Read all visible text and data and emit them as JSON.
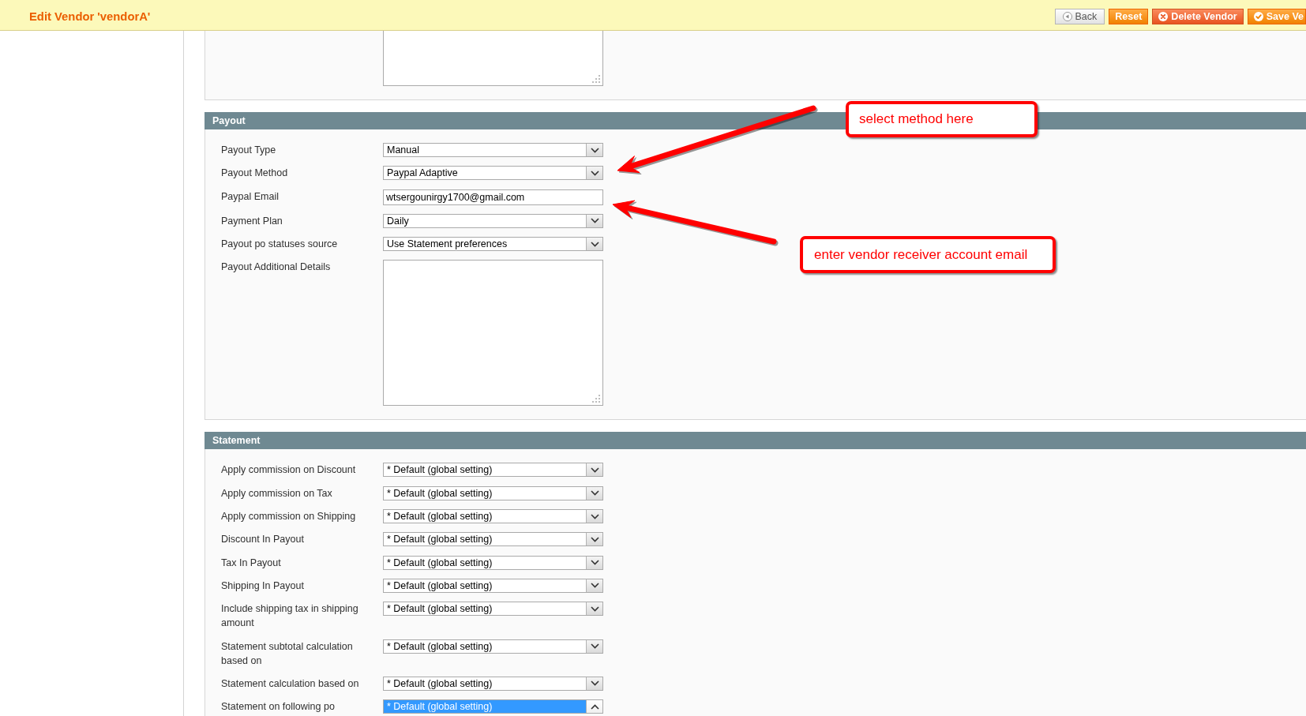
{
  "header": {
    "title": "Edit Vendor 'vendorA'",
    "buttons": [
      {
        "label": "Back",
        "kind": "back"
      },
      {
        "label": "Reset",
        "kind": "reset"
      },
      {
        "label": "Delete Vendor",
        "kind": "delete"
      },
      {
        "label": "Save Ve",
        "kind": "save"
      }
    ]
  },
  "sections": [
    {
      "fields": [
        {
          "kind": "textarea"
        }
      ]
    },
    {
      "title": "Payout",
      "fields": [
        {
          "label": "Payout Type",
          "kind": "select",
          "value": "Manual",
          "expanded": false
        },
        {
          "label": "Payout Method",
          "kind": "select",
          "value": "Paypal Adaptive",
          "expanded": false
        },
        {
          "label": "Paypal Email",
          "kind": "text",
          "value": "wtsergounirgy1700@gmail.com"
        },
        {
          "label": "Payment Plan",
          "kind": "select",
          "value": "Daily",
          "expanded": false
        },
        {
          "label": "Payout po statuses source",
          "kind": "select",
          "value": "Use Statement preferences",
          "expanded": false
        },
        {
          "label": "Payout Additional Details",
          "kind": "textarea"
        }
      ]
    },
    {
      "title": "Statement",
      "fields": [
        {
          "label": "Apply commission on Discount",
          "kind": "select",
          "value": "* Default (global setting)",
          "expanded": false
        },
        {
          "label": "Apply commission on Tax",
          "kind": "select",
          "value": "* Default (global setting)",
          "expanded": false
        },
        {
          "label": "Apply commission on Shipping",
          "kind": "select",
          "value": "* Default (global setting)",
          "expanded": false
        },
        {
          "label": "Discount In Payout",
          "kind": "select",
          "value": "* Default (global setting)",
          "expanded": false
        },
        {
          "label": "Tax In Payout",
          "kind": "select",
          "value": "* Default (global setting)",
          "expanded": false
        },
        {
          "label": "Shipping In Payout",
          "kind": "select",
          "value": "* Default (global setting)",
          "expanded": false
        },
        {
          "label": "Include shipping tax in shipping amount",
          "kind": "select",
          "value": "* Default (global setting)",
          "expanded": false
        },
        {
          "label": "Statement subtotal calculation based on",
          "kind": "select",
          "value": "* Default (global setting)",
          "expanded": false
        },
        {
          "label": "Statement calculation based on",
          "kind": "select",
          "value": "* Default (global setting)",
          "expanded": false
        },
        {
          "label": "Statement on following po",
          "kind": "select",
          "value": "* Default (global setting)",
          "expanded": true
        }
      ]
    }
  ],
  "annotations": [
    {
      "text": "select method here"
    },
    {
      "text": "enter vendor receiver account email"
    }
  ]
}
